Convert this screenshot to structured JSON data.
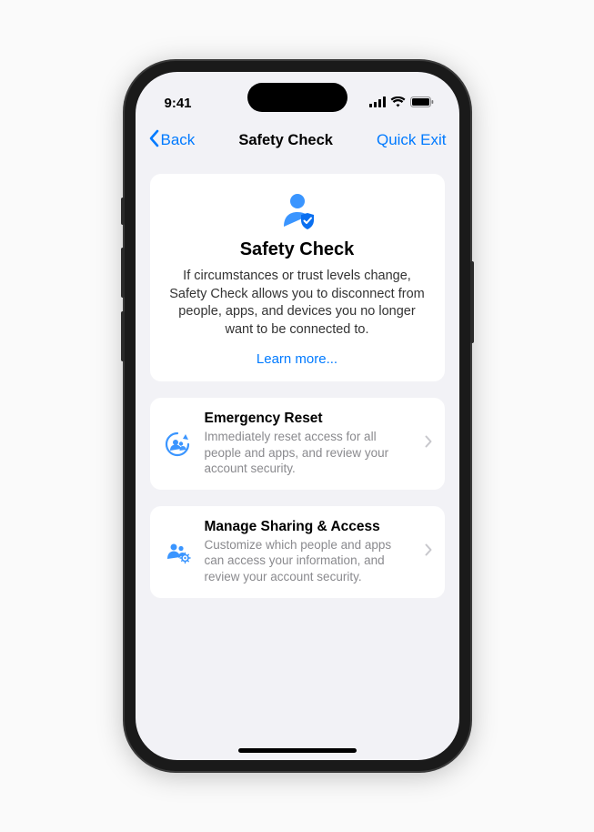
{
  "status": {
    "time": "9:41"
  },
  "nav": {
    "back": "Back",
    "title": "Safety Check",
    "quick_exit": "Quick Exit"
  },
  "intro": {
    "title": "Safety Check",
    "description": "If circumstances or trust levels change, Safety Check allows you to disconnect from people, apps, and devices you no longer want to be connected to.",
    "learn_more": "Learn more..."
  },
  "actions": {
    "emergency": {
      "title": "Emergency Reset",
      "description": "Immediately reset access for all people and apps, and review your account security."
    },
    "manage": {
      "title": "Manage Sharing & Access",
      "description": "Customize which people and apps can access your information, and review your account security."
    }
  }
}
